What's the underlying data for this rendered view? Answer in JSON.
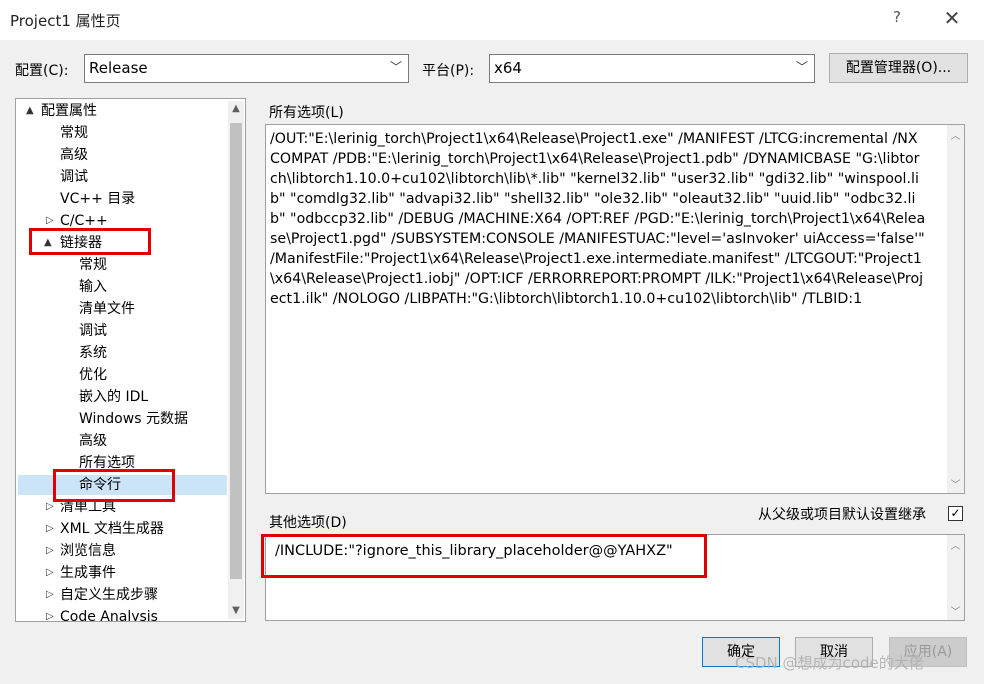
{
  "window": {
    "title": "Project1 属性页",
    "help": "?",
    "close": "✕"
  },
  "config": {
    "label": "配置(C):",
    "value": "Release",
    "platform_label": "平台(P):",
    "platform_value": "x64",
    "manager_button": "配置管理器(O)..."
  },
  "tree": {
    "items": [
      {
        "label": "配置属性",
        "level": 0,
        "expander": "▲"
      },
      {
        "label": "常规",
        "level": 1
      },
      {
        "label": "高级",
        "level": 1
      },
      {
        "label": "调试",
        "level": 1
      },
      {
        "label": "VC++ 目录",
        "level": 1
      },
      {
        "label": "C/C++",
        "level": 1,
        "expander": "▷"
      },
      {
        "label": "链接器",
        "level": 1,
        "expander": "▲"
      },
      {
        "label": "常规",
        "level": 2
      },
      {
        "label": "输入",
        "level": 2
      },
      {
        "label": "清单文件",
        "level": 2
      },
      {
        "label": "调试",
        "level": 2
      },
      {
        "label": "系统",
        "level": 2
      },
      {
        "label": "优化",
        "level": 2
      },
      {
        "label": "嵌入的 IDL",
        "level": 2
      },
      {
        "label": "Windows 元数据",
        "level": 2
      },
      {
        "label": "高级",
        "level": 2
      },
      {
        "label": "所有选项",
        "level": 2
      },
      {
        "label": "命令行",
        "level": 2,
        "selected": true
      },
      {
        "label": "清单工具",
        "level": 1,
        "expander": "▷"
      },
      {
        "label": "XML 文档生成器",
        "level": 1,
        "expander": "▷"
      },
      {
        "label": "浏览信息",
        "level": 1,
        "expander": "▷"
      },
      {
        "label": "生成事件",
        "level": 1,
        "expander": "▷"
      },
      {
        "label": "自定义生成步骤",
        "level": 1,
        "expander": "▷"
      },
      {
        "label": "Code Analysis",
        "level": 1,
        "expander": "▷"
      }
    ]
  },
  "all_options": {
    "label": "所有选项(L)",
    "text": "/OUT:\"E:\\lerinig_torch\\Project1\\x64\\Release\\Project1.exe\" /MANIFEST /LTCG:incremental /NXCOMPAT /PDB:\"E:\\lerinig_torch\\Project1\\x64\\Release\\Project1.pdb\" /DYNAMICBASE \"G:\\libtorch\\libtorch1.10.0+cu102\\libtorch\\lib\\*.lib\" \"kernel32.lib\" \"user32.lib\" \"gdi32.lib\" \"winspool.lib\" \"comdlg32.lib\" \"advapi32.lib\" \"shell32.lib\" \"ole32.lib\" \"oleaut32.lib\" \"uuid.lib\" \"odbc32.lib\" \"odbccp32.lib\" /DEBUG /MACHINE:X64 /OPT:REF /PGD:\"E:\\lerinig_torch\\Project1\\x64\\Release\\Project1.pgd\" /SUBSYSTEM:CONSOLE /MANIFESTUAC:\"level='asInvoker' uiAccess='false'\" /ManifestFile:\"Project1\\x64\\Release\\Project1.exe.intermediate.manifest\" /LTCGOUT:\"Project1\\x64\\Release\\Project1.iobj\" /OPT:ICF /ERRORREPORT:PROMPT /ILK:\"Project1\\x64\\Release\\Project1.ilk\" /NOLOGO /LIBPATH:\"G:\\libtorch\\libtorch1.10.0+cu102\\libtorch\\lib\" /TLBID:1"
  },
  "other_options": {
    "label": "其他选项(D)",
    "inherit_label": "从父级或项目默认设置继承",
    "inherit_checked": "✓",
    "value": "/INCLUDE:\"?ignore_this_library_placeholder@@YAHXZ\""
  },
  "buttons": {
    "ok": "确定",
    "cancel": "取消",
    "apply": "应用(A)"
  },
  "watermark": "CSDN @想成为code的大佬"
}
